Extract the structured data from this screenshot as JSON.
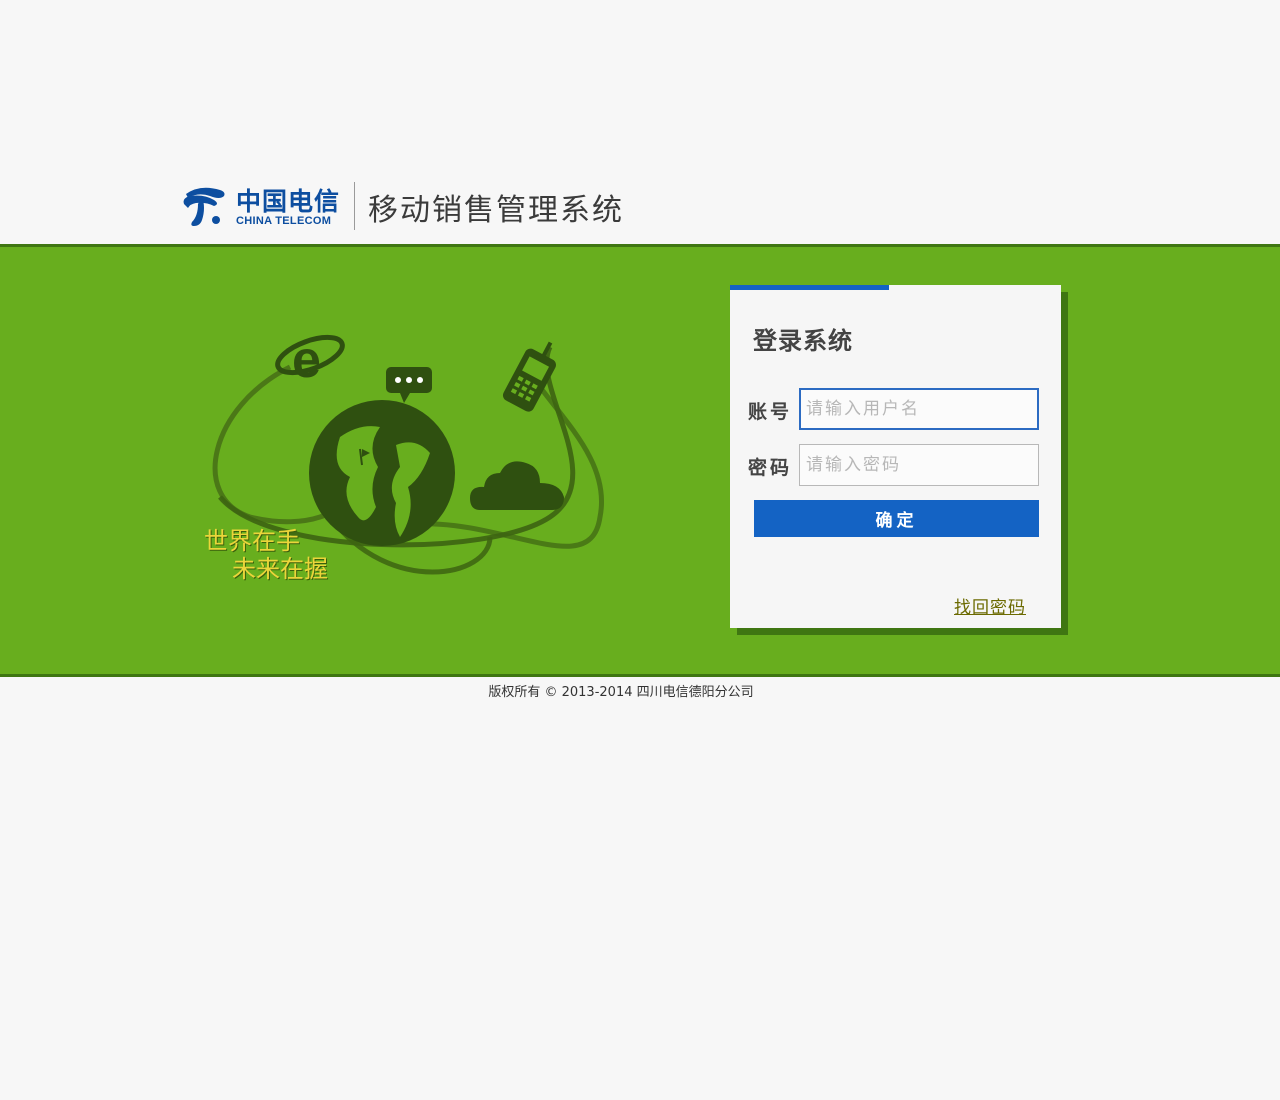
{
  "header": {
    "logo_cn": "中国电信",
    "logo_en": "CHINA TELECOM",
    "system_title": "移动销售管理系统"
  },
  "banner": {
    "slogan_line1": "世界在手",
    "slogan_line2": "未来在握",
    "icons": [
      "internet-explorer-icon",
      "chat-bubble-icon",
      "mobile-phone-icon",
      "globe-icon",
      "cloud-icon"
    ]
  },
  "login": {
    "title": "登录系统",
    "account_label": "账号",
    "account_placeholder": "请输入用户名",
    "password_label": "密码",
    "password_placeholder": "请输入密码",
    "submit_label": "确定",
    "forgot_label": "找回密码"
  },
  "footer": {
    "copyright": "版权所有 © 2013-2014 四川电信德阳分公司"
  },
  "colors": {
    "brand_blue": "#1463c4",
    "banner_green": "#68ae1e",
    "banner_dark_green": "#3f7612",
    "slogan_yellow": "#ebd53a"
  }
}
